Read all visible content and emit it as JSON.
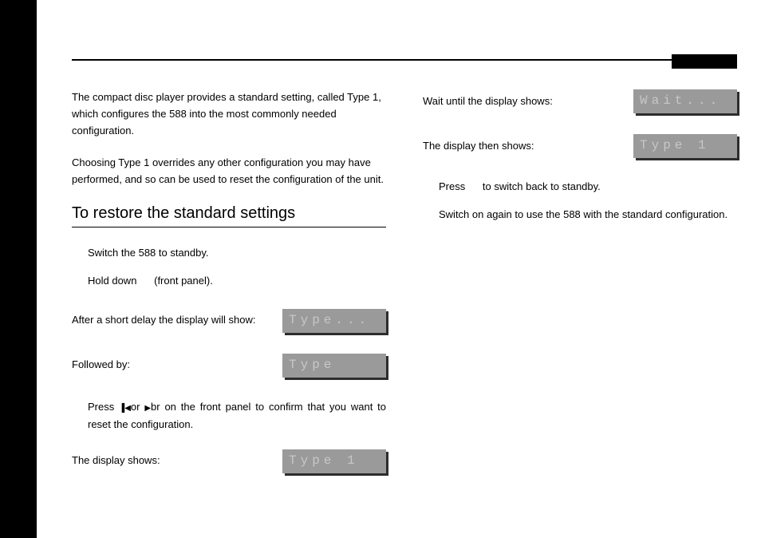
{
  "intro1": "The compact disc player provides a standard setting, called Type 1, which configures the 588 into the most commonly needed configuration.",
  "intro2": "Choosing Type 1 overrides any other configuration you may have performed, and so can be used to reset the configuration of the unit.",
  "heading": "To restore the standard settings",
  "step1": "Switch the 588 to standby.",
  "step2_a": "Hold down",
  "step2_b": "(front panel).",
  "afterDelay": "After a short delay the display will show:",
  "disp_type_dots": "Type...",
  "followed": "Followed by:",
  "disp_type": "Type",
  "pressLine_a": "Press ",
  "pressLine_mid": "or ",
  "pressLine_b": "br on the front panel to confirm that you want to reset the configuration.",
  "displayShows": "The display shows:",
  "disp_type1": "Type 1",
  "waitUntil": "Wait until the display shows:",
  "disp_wait": "Wait...",
  "displayThen": "The display then shows:",
  "disp_type1_b": "Type 1",
  "pressSwitch_a": "Press",
  "pressSwitch_b": "to switch back to standby.",
  "switchAgain": "Switch on again to use the 588 with the standard configuration."
}
